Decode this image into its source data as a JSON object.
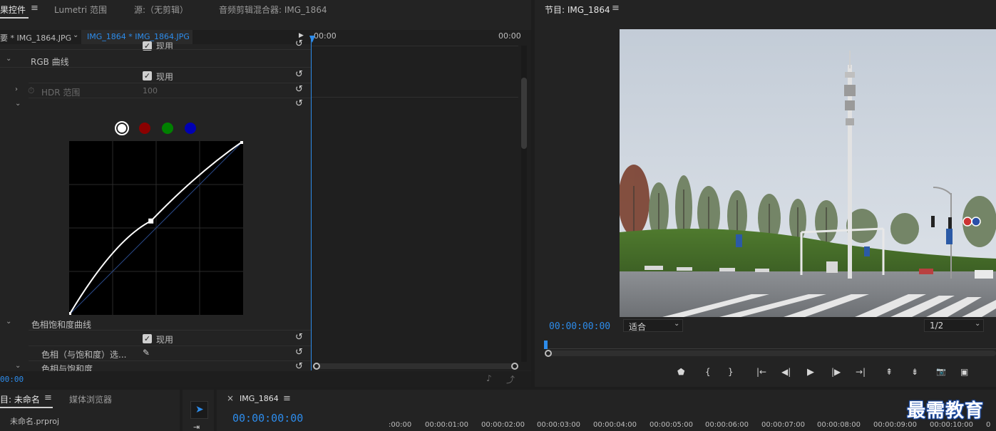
{
  "effect_controls": {
    "tabs": [
      "果控件",
      "Lumetri 范围",
      "源:（无剪辑）",
      "音频剪辑混合器: IMG_1864"
    ],
    "menu_glyph": "≡",
    "clip_source": "要 * IMG_1864.JPG",
    "clip_active": "IMG_1864 * IMG_1864.JPG",
    "timeline_start": "00:00",
    "timeline_end": "00:00",
    "enable_label": "现用",
    "rgb_curves_label": "RGB 曲线",
    "hdr_range_label": "HDR 范围",
    "hdr_range_value": "100",
    "hue_sat_curves_label": "色相饱和度曲线",
    "hue_vs_sat_selector_label": "色相（与饱和度）选...",
    "hue_vs_sat_label": "色相与饱和度",
    "bottom_timecode": "00:00",
    "channel_colors": {
      "white": "#ffffff",
      "red": "#8b0000",
      "green": "#008000",
      "blue": "#0000b3"
    },
    "curve_point": {
      "input": 0.47,
      "output": 0.54
    }
  },
  "program_monitor": {
    "title": "节目: IMG_1864",
    "menu_glyph": "≡",
    "timecode": "00:00:00:00",
    "zoom_select": "适合",
    "resolution_select": "1/2",
    "preview_image": "street-scene-with-cell-tower",
    "transport_icons": [
      "add-marker-icon",
      "mark-in-icon",
      "mark-out-icon",
      "go-to-in-icon",
      "step-back-icon",
      "play-icon",
      "step-forward-icon",
      "go-to-out-icon",
      "lift-icon",
      "extract-icon",
      "export-frame-icon",
      "compare-view-icon"
    ],
    "transport_glyphs": [
      "⬟",
      "{",
      "}",
      "|←",
      "◀|",
      "▶",
      "|▶",
      "→|",
      "⇞",
      "⇟",
      "📷",
      "▣"
    ]
  },
  "project_panel": {
    "tabs": [
      "目: 未命名",
      "媒体浏览器"
    ],
    "menu_glyph": "≡",
    "file_name": "未命名.prproj"
  },
  "timeline_panel": {
    "close_glyph": "×",
    "sequence_name": "IMG_1864",
    "menu_glyph": "≡",
    "timecode": "00:00:00:00",
    "ruler": [
      ":00:00",
      "00:00:01:00",
      "00:00:02:00",
      "00:00:03:00",
      "00:00:04:00",
      "00:00:05:00",
      "00:00:06:00",
      "00:00:07:00",
      "00:00:08:00",
      "00:00:09:00",
      "00:00:10:00",
      "0"
    ]
  },
  "watermark": "最需教育",
  "accent_color": "#2d8ceb"
}
